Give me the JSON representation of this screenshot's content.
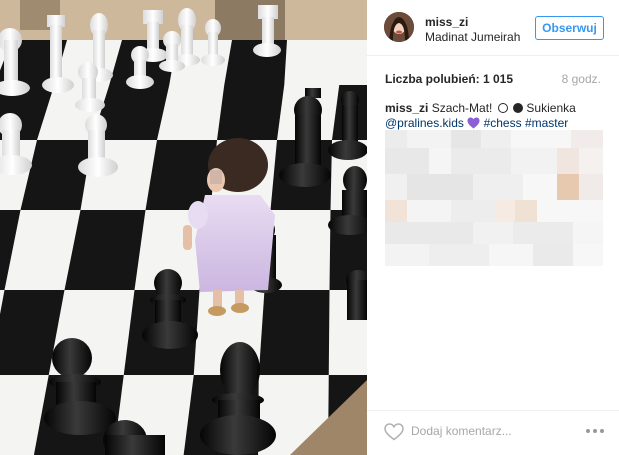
{
  "post": {
    "username": "miss_zi",
    "location": "Madinat Jumeirah",
    "follow_label": "Obserwuj",
    "likes_text": "Liczba polubień: 1 015",
    "time_ago": "8 godz.",
    "caption": {
      "user": "miss_zi",
      "text_before_icons": "Szach-Mat!",
      "text_after_icons": "Sukienka",
      "mention": "@pralines.kids",
      "hashtag_1": "#chess",
      "hashtag_2": "#master"
    },
    "comment_placeholder": "Dodaj komentarz...",
    "more_label": "..."
  },
  "icons": {
    "outline_circle": "white-circle-icon",
    "filled_circle": "black-circle-icon",
    "purple_heart": "purple-heart-icon",
    "like": "heart-outline-icon",
    "more": "more-options-icon"
  },
  "colors": {
    "follow_accent": "#3897f0",
    "link": "#003569",
    "muted": "#a5a7aa",
    "purple_heart": "#8c5fd6"
  }
}
